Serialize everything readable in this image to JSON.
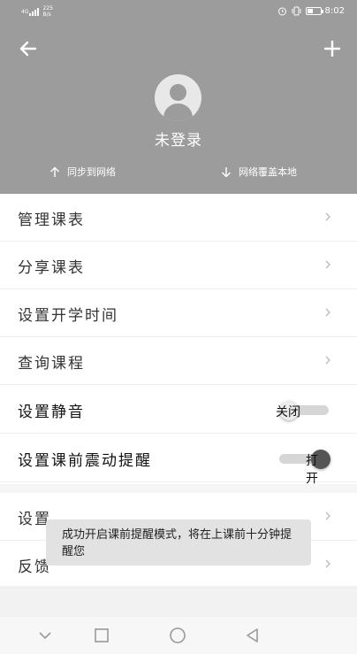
{
  "status_bar": {
    "network": "4G",
    "speed_value": "225",
    "speed_unit": "B/s",
    "time": "8:02",
    "battery_level": 0.45
  },
  "header": {
    "back_icon": "arrow-left-icon",
    "add_icon": "plus-icon",
    "username": "未登录",
    "sync_up_label": "同步到网络",
    "sync_down_label": "网络覆盖本地"
  },
  "menu": {
    "items": [
      {
        "label": "管理课表"
      },
      {
        "label": "分享课表"
      },
      {
        "label": "设置开学时间"
      },
      {
        "label": "查询课程"
      }
    ],
    "mute": {
      "label": "设置静音",
      "state_label": "关闭",
      "on": false
    },
    "vibrate": {
      "label": "设置课前震动提醒",
      "state_label": "打开",
      "on": true
    },
    "settings_label": "设置",
    "feedback_label": "反馈"
  },
  "toast": {
    "message": "成功开启课前提醒模式，将在上课前十分钟提醒您"
  },
  "colors": {
    "header_bg": "#9c9c9c",
    "menu_bg": "#ffffff",
    "toast_bg": "#e2e2e2"
  }
}
